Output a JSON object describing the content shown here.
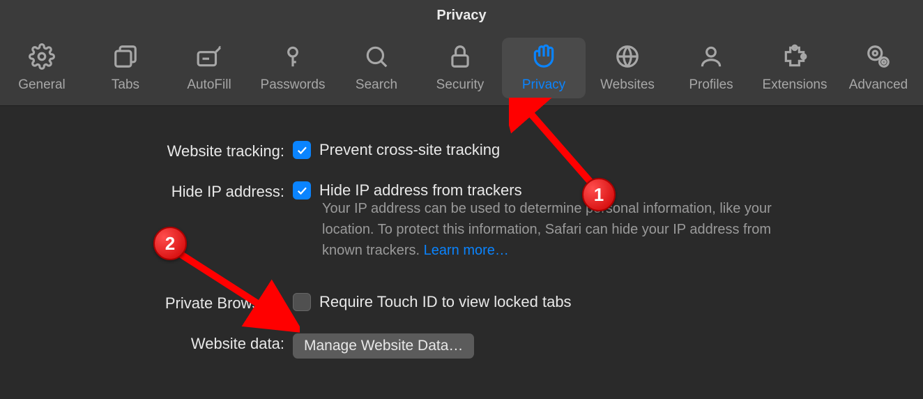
{
  "window": {
    "title": "Privacy"
  },
  "toolbar": {
    "items": [
      {
        "label": "General",
        "icon": "gear-icon"
      },
      {
        "label": "Tabs",
        "icon": "tabs-icon"
      },
      {
        "label": "AutoFill",
        "icon": "autofill-icon"
      },
      {
        "label": "Passwords",
        "icon": "key-icon"
      },
      {
        "label": "Search",
        "icon": "search-icon"
      },
      {
        "label": "Security",
        "icon": "lock-icon"
      },
      {
        "label": "Privacy",
        "icon": "hand-icon",
        "active": true
      },
      {
        "label": "Websites",
        "icon": "globe-icon"
      },
      {
        "label": "Profiles",
        "icon": "profile-icon"
      },
      {
        "label": "Extensions",
        "icon": "puzzle-icon"
      },
      {
        "label": "Advanced",
        "icon": "gears-icon"
      }
    ]
  },
  "settings": {
    "website_tracking": {
      "label": "Website tracking:",
      "checkbox_label": "Prevent cross-site tracking",
      "checked": true
    },
    "hide_ip": {
      "label": "Hide IP address:",
      "checkbox_label": "Hide IP address from trackers",
      "checked": true,
      "description": "Your IP address can be used to determine personal information, like your location. To protect this information, Safari can hide your IP address from known trackers. ",
      "learn_more": "Learn more…"
    },
    "private_browsing": {
      "label": "Private Browsing:",
      "checkbox_label": "Require Touch ID to view locked tabs",
      "checked": false
    },
    "website_data": {
      "label": "Website data:",
      "button_label": "Manage Website Data…"
    }
  },
  "annotations": {
    "badge1": "1",
    "badge2": "2"
  }
}
